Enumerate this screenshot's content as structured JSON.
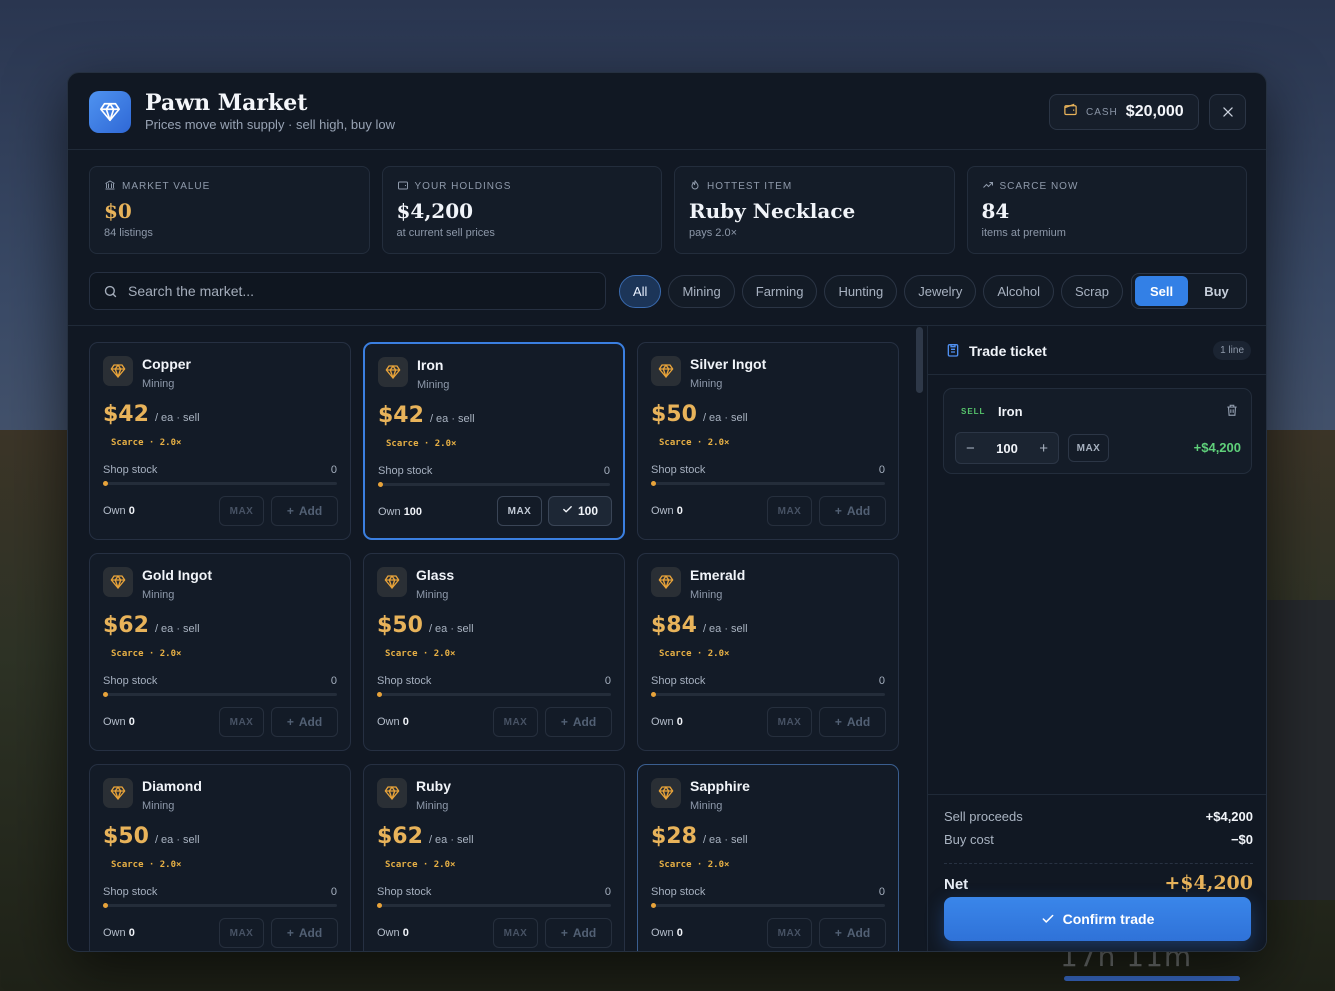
{
  "header": {
    "title": "Pawn Market",
    "subtitle": "Prices move with supply · sell high, buy low",
    "cash_label": "CASH",
    "cash_value": "$20,000"
  },
  "stats": [
    {
      "label": "MARKET VALUE",
      "value": "$0",
      "sub": "84 listings",
      "icon": "bank-icon"
    },
    {
      "label": "YOUR HOLDINGS",
      "value": "$4,200",
      "sub": "at current sell prices",
      "icon": "wallet-icon"
    },
    {
      "label": "HOTTEST ITEM",
      "value": "Ruby Necklace",
      "sub": "pays 2.0×",
      "icon": "flame-icon"
    },
    {
      "label": "SCARCE NOW",
      "value": "84",
      "sub": "items at premium",
      "icon": "trend-up-icon"
    }
  ],
  "search": {
    "placeholder": "Search the market..."
  },
  "filters": [
    "All",
    "Mining",
    "Farming",
    "Hunting",
    "Jewelry",
    "Alcohol",
    "Scrap"
  ],
  "active_filter": "All",
  "mode": {
    "sell": "Sell",
    "buy": "Buy",
    "active": "Sell"
  },
  "card_labels": {
    "unit": "/ ea · sell",
    "stock": "Shop stock",
    "own": "Own",
    "max": "MAX",
    "add": "Add"
  },
  "items": [
    {
      "name": "Copper",
      "category": "Mining",
      "price": "$42",
      "tag": "Scarce · 2.0×",
      "stock": "0",
      "own": "0",
      "state": "normal"
    },
    {
      "name": "Iron",
      "category": "Mining",
      "price": "$42",
      "tag": "Scarce · 2.0×",
      "stock": "0",
      "own": "100",
      "state": "selected",
      "added": "100"
    },
    {
      "name": "Silver Ingot",
      "category": "Mining",
      "price": "$50",
      "tag": "Scarce · 2.0×",
      "stock": "0",
      "own": "0",
      "state": "normal"
    },
    {
      "name": "Gold Ingot",
      "category": "Mining",
      "price": "$62",
      "tag": "Scarce · 2.0×",
      "stock": "0",
      "own": "0",
      "state": "normal"
    },
    {
      "name": "Glass",
      "category": "Mining",
      "price": "$50",
      "tag": "Scarce · 2.0×",
      "stock": "0",
      "own": "0",
      "state": "normal"
    },
    {
      "name": "Emerald",
      "category": "Mining",
      "price": "$84",
      "tag": "Scarce · 2.0×",
      "stock": "0",
      "own": "0",
      "state": "normal"
    },
    {
      "name": "Diamond",
      "category": "Mining",
      "price": "$50",
      "tag": "Scarce · 2.0×",
      "stock": "0",
      "own": "0",
      "state": "normal"
    },
    {
      "name": "Ruby",
      "category": "Mining",
      "price": "$62",
      "tag": "Scarce · 2.0×",
      "stock": "0",
      "own": "0",
      "state": "normal"
    },
    {
      "name": "Sapphire",
      "category": "Mining",
      "price": "$28",
      "tag": "Scarce · 2.0×",
      "stock": "0",
      "own": "0",
      "state": "hover"
    }
  ],
  "ticket": {
    "title": "Trade ticket",
    "badge": "1 line",
    "line": {
      "side": "SELL",
      "name": "Iron",
      "qty": "100",
      "max": "MAX",
      "amount": "+$4,200"
    },
    "sell_label": "Sell proceeds",
    "sell_value": "+$4,200",
    "buy_label": "Buy cost",
    "buy_value": "−$0",
    "net_label": "Net",
    "net_value": "+$4,200",
    "confirm": "Confirm trade"
  },
  "hud": {
    "text": "17h 11m"
  },
  "colors": {
    "accent": "#3380e6",
    "gold": "#e8b35a",
    "positive": "#5fd07a"
  }
}
